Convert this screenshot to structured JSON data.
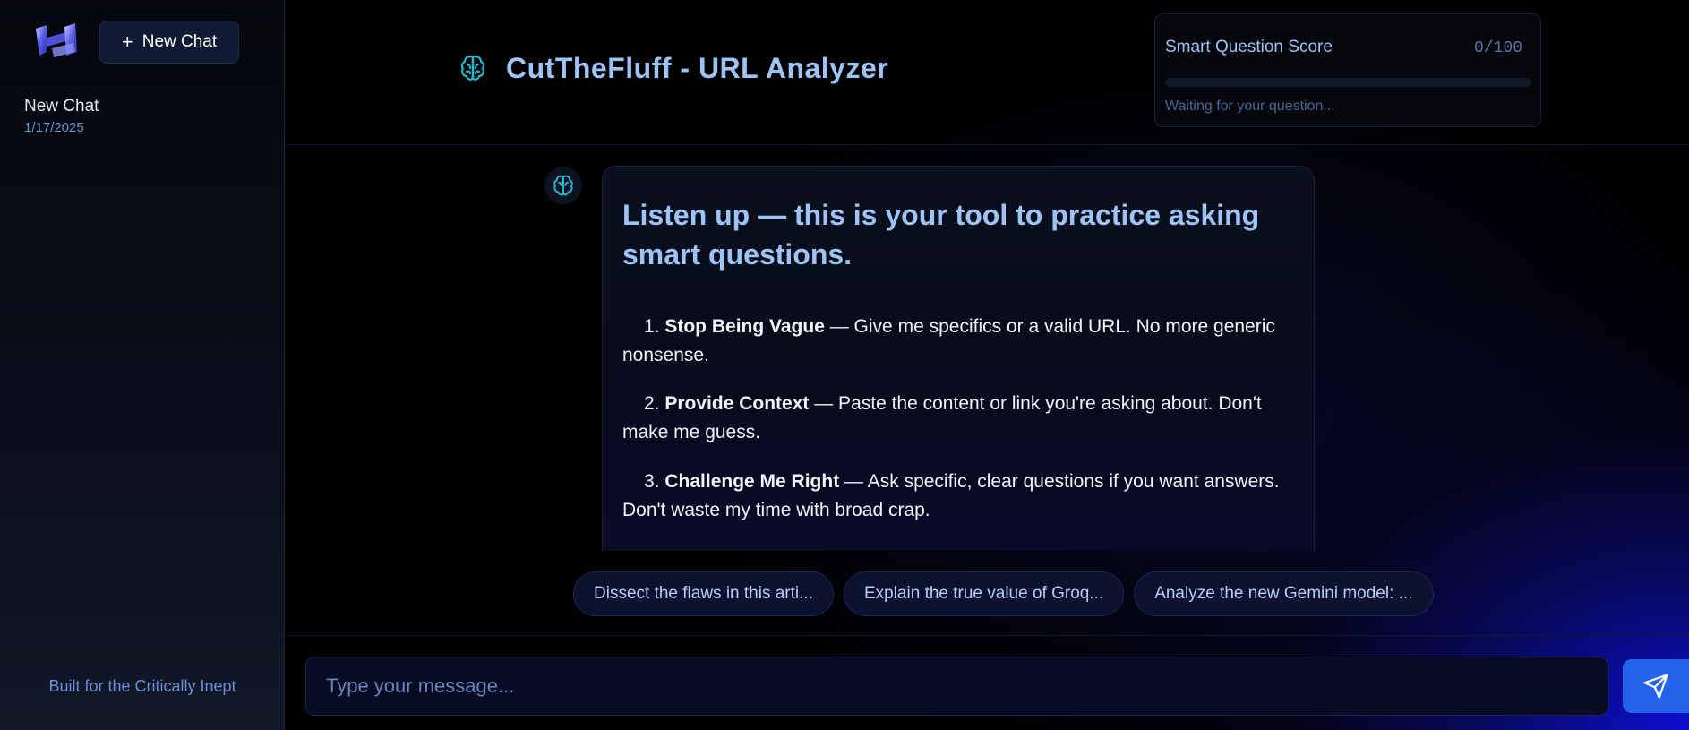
{
  "sidebar": {
    "new_chat_label": "New Chat",
    "chats": [
      {
        "title": "New Chat",
        "date": "1/17/2025"
      }
    ],
    "footer": "Built for the Critically Inept"
  },
  "header": {
    "title": "CutTheFluff - URL Analyzer",
    "score": {
      "label": "Smart Question Score",
      "value": "0/100",
      "progress_percent": 0,
      "status": "Waiting for your question..."
    }
  },
  "message": {
    "heading": "Listen up — this is your tool to practice asking smart questions.",
    "items": [
      {
        "num": "1.",
        "bold": "Stop Being Vague",
        "text": " — Give me specifics or a valid URL. No more generic nonsense."
      },
      {
        "num": "2.",
        "bold": "Provide Context",
        "text": " — Paste the content or link you're asking about. Don't make me guess."
      },
      {
        "num": "3.",
        "bold": "Challenge Me Right",
        "text": " — Ask specific, clear questions if you want answers. Don't waste my time with broad crap."
      }
    ]
  },
  "suggestions": [
    "Dissect the flaws in this arti...",
    "Explain the true value of Groq...",
    "Analyze the new Gemini model: ..."
  ],
  "input": {
    "placeholder": "Type your message..."
  },
  "colors": {
    "accent": "#9ec3f5",
    "brain_icon": "#22b8cf",
    "send_button": "#2563eb"
  },
  "icons": {
    "logo": "h-logo-icon",
    "brand": "brain-icon",
    "send": "send-icon",
    "plus": "plus-icon"
  }
}
